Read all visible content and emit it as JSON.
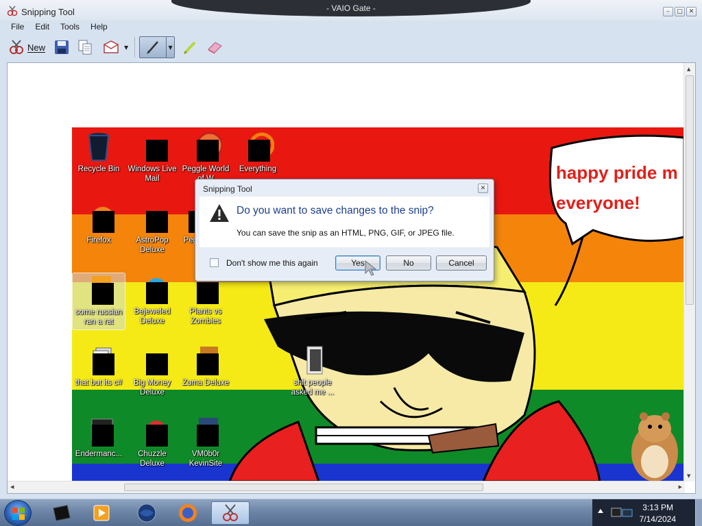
{
  "window": {
    "title": "Snipping Tool",
    "top_center_title": "- VAIO Gate -",
    "controls": {
      "minimize": "–",
      "maximize": "□",
      "close": "✕"
    }
  },
  "menu": [
    "File",
    "Edit",
    "Tools",
    "Help"
  ],
  "toolbar": {
    "new_label": "New",
    "dropdown_glyph": "▼"
  },
  "canvas": {
    "speech_bubble_text": [
      "happy pride m",
      "everyone!"
    ],
    "desktop_icons": [
      {
        "label": "Recycle Bin"
      },
      {
        "label": "Windows Live Mail"
      },
      {
        "label": "Peggle World of W"
      },
      {
        "label": "Everything"
      },
      {
        "label": "Firefox"
      },
      {
        "label": "AstroPop Deluxe"
      },
      {
        "label": "Pegg"
      },
      {
        "label": "some russian ran a rat"
      },
      {
        "label": "Bejeweled Deluxe"
      },
      {
        "label": "Plants vs Zombies"
      },
      {
        "label": "that but its c#"
      },
      {
        "label": "Big Money Deluxe"
      },
      {
        "label": "Zuma Deluxe"
      },
      {
        "label": "Endermanc..."
      },
      {
        "label": "Chuzzle Deluxe"
      },
      {
        "label": "VM0b0r KevinSite"
      },
      {
        "label": "shit people asked me ..."
      }
    ]
  },
  "dialog": {
    "title": "Snipping Tool",
    "heading": "Do you want to save changes to the snip?",
    "message": "You can save the snip as an HTML, PNG, GIF, or JPEG file.",
    "checkbox_label": "Don't show me this again",
    "checkbox_checked": false,
    "buttons": {
      "yes": "Yes",
      "no": "No",
      "cancel": "Cancel"
    }
  },
  "taskbar": {
    "clock_time": "3:13 PM",
    "clock_date": "7/14/2024"
  }
}
